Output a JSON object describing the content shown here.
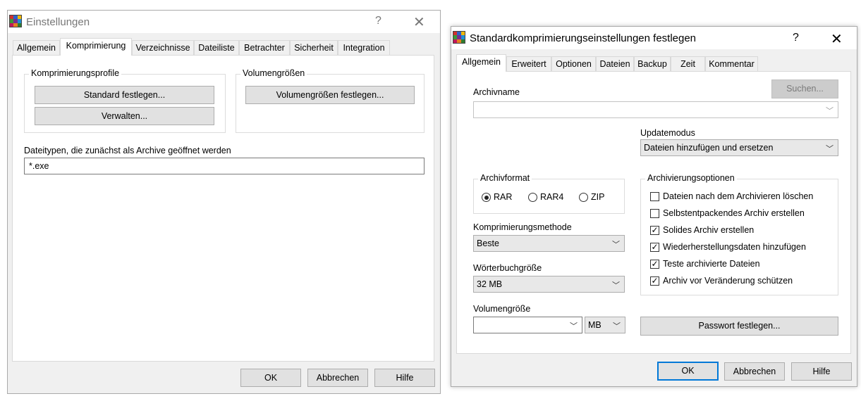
{
  "dialog1": {
    "title": "Einstellungen",
    "help_glyph": "?",
    "close_glyph": "✕",
    "tabs": [
      "Allgemein",
      "Komprimierung",
      "Verzeichnisse",
      "Dateiliste",
      "Betrachter",
      "Sicherheit",
      "Integration"
    ],
    "profiles_legend": "Komprimierungsprofile",
    "standard_button": "Standard festlegen...",
    "manage_button": "Verwalten...",
    "volume_legend": "Volumengrößen",
    "volume_button": "Volumengrößen festlegen...",
    "filetypes_label": "Dateitypen, die zunächst als Archive geöffnet werden",
    "filetypes_value": "*.exe",
    "ok": "OK",
    "cancel": "Abbrechen",
    "help": "Hilfe"
  },
  "dialog2": {
    "title": "Standardkomprimierungseinstellungen festlegen",
    "help_glyph": "?",
    "close_glyph": "✕",
    "tabs": [
      "Allgemein",
      "Erweitert",
      "Optionen",
      "Dateien",
      "Backup",
      "Zeit",
      "Kommentar"
    ],
    "archive_name_label": "Archivname",
    "archive_name_value": "",
    "browse_button": "Suchen...",
    "update_mode_label": "Updatemodus",
    "update_mode_value": "Dateien hinzufügen und ersetzen",
    "format_legend": "Archivformat",
    "formats": [
      "RAR",
      "RAR4",
      "ZIP"
    ],
    "selected_format": "RAR",
    "options_legend": "Archivierungsoptionen",
    "options": [
      {
        "label": "Dateien nach dem Archivieren löschen",
        "checked": false
      },
      {
        "label": "Selbstentpackendes Archiv erstellen",
        "checked": false
      },
      {
        "label": "Solides Archiv erstellen",
        "checked": true
      },
      {
        "label": "Wiederherstellungsdaten hinzufügen",
        "checked": true
      },
      {
        "label": "Teste archivierte Dateien",
        "checked": true
      },
      {
        "label": "Archiv vor Veränderung schützen",
        "checked": true
      }
    ],
    "method_label": "Komprimierungsmethode",
    "method_value": "Beste",
    "dict_label": "Wörterbuchgröße",
    "dict_value": "32 MB",
    "volume_label": "Volumengröße",
    "volume_value": "",
    "volume_unit": "MB",
    "password_button": "Passwort festlegen...",
    "ok": "OK",
    "cancel": "Abbrechen",
    "help": "Hilfe"
  },
  "colors": {
    "icon": [
      "#d0312d",
      "#2a62c9",
      "#f2b705",
      "#3a9a3a",
      "#7a2d8f",
      "#1f8fd6",
      "#c2185b",
      "#e67e22",
      "#2e7d32"
    ],
    "accent": "#0078d7"
  }
}
